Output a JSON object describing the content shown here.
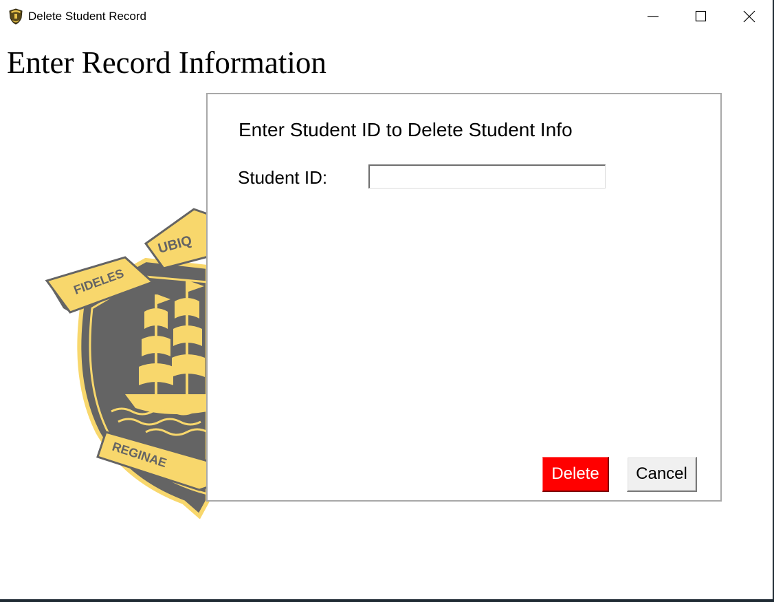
{
  "window": {
    "title": "Delete Student Record",
    "icon": "school-crest-icon",
    "controls": {
      "minimize": "minimize-icon",
      "maximize": "maximize-icon",
      "close": "close-icon"
    }
  },
  "page": {
    "heading": "Enter Record Information"
  },
  "crest": {
    "motto_left": "FIDELES",
    "motto_top": "UBIQ",
    "motto_bottom": "REGINAE",
    "colors": {
      "shield": "#646464",
      "gold": "#f8d76c"
    }
  },
  "dialog": {
    "title": "Enter Student ID to Delete Student Info",
    "student_id_label": "Student ID:",
    "student_id_value": "",
    "delete_label": "Delete",
    "cancel_label": "Cancel",
    "colors": {
      "delete_bg": "#ff0000",
      "delete_text": "#ffffff",
      "cancel_bg": "#f0f0f0"
    }
  }
}
